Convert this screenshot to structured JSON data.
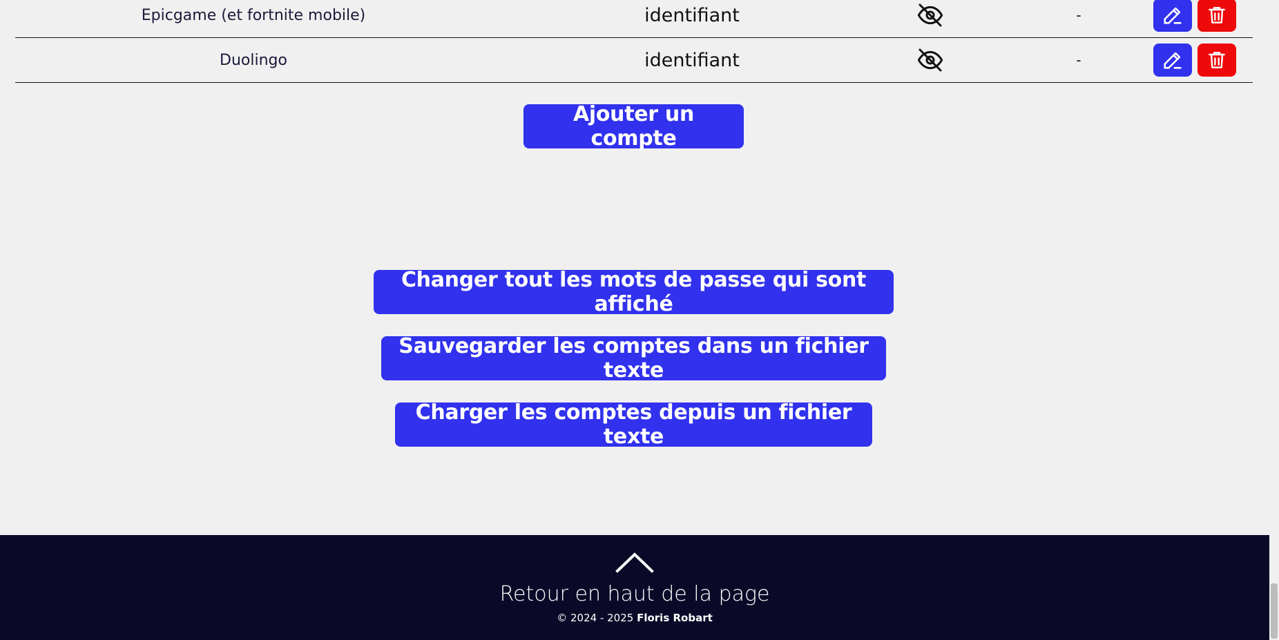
{
  "accounts": [
    {
      "name": "Epicgame (et fortnite mobile)",
      "identifier": "identifiant",
      "password_icon": "eye-off-icon",
      "note": "-"
    },
    {
      "name": "Duolingo",
      "identifier": "identifiant",
      "password_icon": "eye-off-icon",
      "note": "-"
    }
  ],
  "buttons": {
    "add_account": "Ajouter un compte",
    "change_passwords": "Changer tout les mots de passe qui sont affiché",
    "save_accounts": "Sauvegarder les comptes dans un fichier texte",
    "load_accounts": "Charger les comptes depuis un fichier texte"
  },
  "footer": {
    "back_to_top": "Retour en haut de la page",
    "copyright_prefix": "© 2024 - 2025",
    "author": "Floris Robart",
    "icon": "chevron-up-icon"
  },
  "colors": {
    "accent": "#3131ee",
    "danger": "#ee0a0a",
    "footer_bg": "#0a0a28",
    "page_bg": "#f0f0f0"
  }
}
